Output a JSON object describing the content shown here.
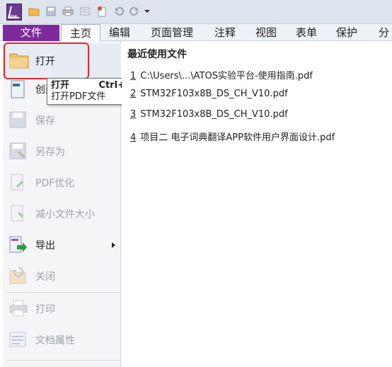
{
  "tabs": [
    {
      "label": "文件"
    },
    {
      "label": "主页"
    },
    {
      "label": "编辑"
    },
    {
      "label": "页面管理"
    },
    {
      "label": "注释"
    },
    {
      "label": "视图"
    },
    {
      "label": "表单"
    },
    {
      "label": "保护"
    },
    {
      "label": "分"
    }
  ],
  "menu": {
    "open": "打开",
    "create": "创建",
    "save": "保存",
    "save_as": "另存为",
    "optimize": "PDF优化",
    "reduce": "减小文件大小",
    "export": "导出",
    "close": "关闭",
    "print": "打印",
    "properties": "文档属性"
  },
  "tooltip": {
    "title": "打开",
    "shortcut": "Ctrl+O",
    "desc": "打开PDF文件"
  },
  "recent": {
    "title": "最近使用文件",
    "items": [
      {
        "num": "1",
        "name": "C:\\Users\\...\\ATOS实验平台-使用指南.pdf"
      },
      {
        "num": "2",
        "name": "STM32F103x8B_DS_CH_V10.pdf"
      },
      {
        "num": "3",
        "name": "STM32F103x8B_DS_CH_V10.pdf"
      },
      {
        "num": "4",
        "name": "项目二 电子词典翻译APP软件用户界面设计.pdf"
      }
    ]
  },
  "colors": {
    "file_tab": "#7d2a9e",
    "highlight_box": "#e22a2a"
  }
}
